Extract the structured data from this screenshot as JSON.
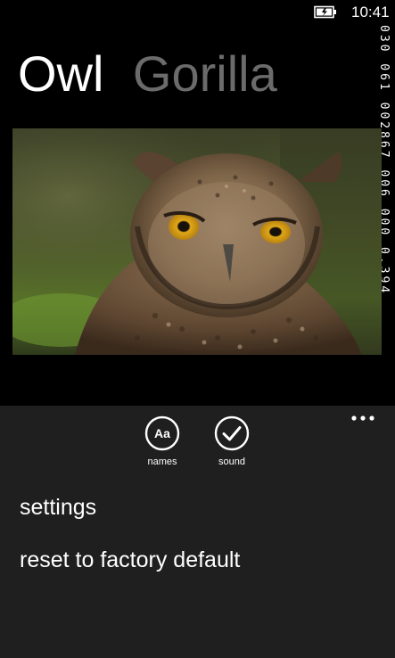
{
  "status_bar": {
    "time": "10:41",
    "battery_icon": "battery-charging-icon"
  },
  "debug_counters": {
    "text": "030 061 002867 006 000 0.394"
  },
  "pivot": {
    "items": [
      {
        "label": "Owl",
        "active": true
      },
      {
        "label": "Gorilla",
        "active": false
      }
    ]
  },
  "photo": {
    "subject": "owl"
  },
  "app_bar": {
    "more_icon": "ellipsis-icon",
    "buttons": [
      {
        "label": "names",
        "glyph": "Aa",
        "icon": "font-icon"
      },
      {
        "label": "sound",
        "icon": "check-icon"
      }
    ],
    "menu_items": [
      {
        "label": "settings"
      },
      {
        "label": "reset to factory default"
      }
    ]
  },
  "colors": {
    "background": "#000000",
    "app_bar": "#1f1f1f",
    "inactive_header": "#6b6b6b",
    "foreground": "#ffffff"
  }
}
